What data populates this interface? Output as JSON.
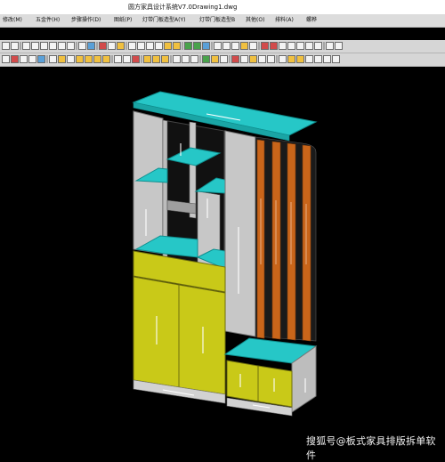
{
  "window": {
    "app_title": "圆方家具设计系统V7.0",
    "document_title": "Drawing1.dwg"
  },
  "menu": {
    "items": [
      {
        "label": "修改(M)"
      },
      {
        "label": "五金件(H)"
      },
      {
        "label": "步骤操作(D)"
      },
      {
        "label": "图纸(P)"
      },
      {
        "label": "灯带门板造型A(Y)"
      },
      {
        "label": "灯带门板造型B"
      },
      {
        "label": "其他(O)"
      },
      {
        "label": "排料(A)"
      },
      {
        "label": "螺桦"
      }
    ]
  },
  "viewport": {
    "model": "cabinet-3d",
    "background": "#000000",
    "colors": {
      "panel_gray": "#c7c7c7",
      "top_cyan": "#26c7c7",
      "door_yellow": "#c9c918",
      "slat_orange": "#c9651a",
      "arrow_white": "#ffffff"
    }
  },
  "watermark": {
    "text": "搜狐号@板式家具排版拆单软件"
  }
}
